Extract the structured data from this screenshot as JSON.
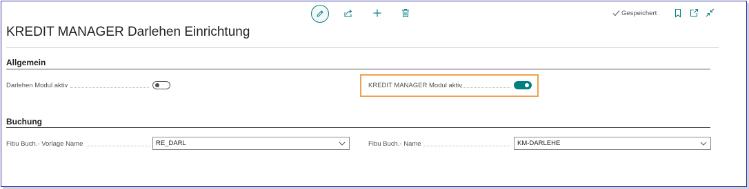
{
  "toolbar": {
    "edit_icon": "pencil-icon",
    "share_icon": "share-icon",
    "add_icon": "plus-icon",
    "delete_icon": "trash-icon",
    "status_label": "Gespeichert",
    "bookmark_icon": "bookmark-icon",
    "popout_icon": "open-new-window-icon",
    "collapse_icon": "collapse-icon"
  },
  "page": {
    "title": "KREDIT MANAGER Darlehen Einrichtung"
  },
  "sections": [
    {
      "title": "Allgemein",
      "fields": [
        {
          "label": "Darlehen Modul aktiv",
          "type": "toggle",
          "value": false
        },
        {
          "label": "KREDIT MANAGER Modul aktiv",
          "type": "toggle",
          "value": true,
          "highlighted": true
        }
      ]
    },
    {
      "title": "Buchung",
      "fields": [
        {
          "label": "Fibu Buch.- Vorlage Name",
          "type": "select",
          "value": "RE_DARL"
        },
        {
          "label": "Fibu Buch.- Name",
          "type": "select",
          "value": "KM-DARLEHE"
        }
      ]
    }
  ],
  "colors": {
    "accent": "#00807f",
    "highlight": "#f0a050",
    "frame": "#2b2f9e"
  }
}
